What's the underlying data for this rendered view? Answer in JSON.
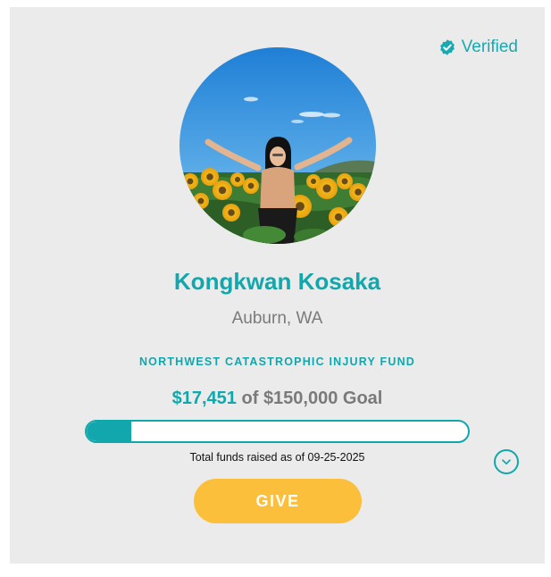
{
  "verified": {
    "label": "Verified",
    "icon": "verified-badge-icon",
    "color": "#1aa9b0"
  },
  "profile": {
    "name": "Kongkwan Kosaka",
    "location": "Auburn, WA",
    "photo_alt": "Profile photo"
  },
  "fund": {
    "name": "NORTHWEST CATASTROPHIC INJURY FUND"
  },
  "fundraising": {
    "raised": "$17,451",
    "of_text": "of",
    "goal": "$150,000 Goal",
    "raised_value": 17451,
    "goal_value": 150000,
    "progress_fraction": 0.1163,
    "as_of_text": "Total funds raised as of 09-25-2025"
  },
  "actions": {
    "give_label": "GIVE",
    "expand_icon": "chevron-down-icon"
  },
  "colors": {
    "accent": "#12a7ad",
    "button": "#fbbf3c",
    "card_background": "#ebebeb",
    "muted_text": "#7a7a7a"
  }
}
